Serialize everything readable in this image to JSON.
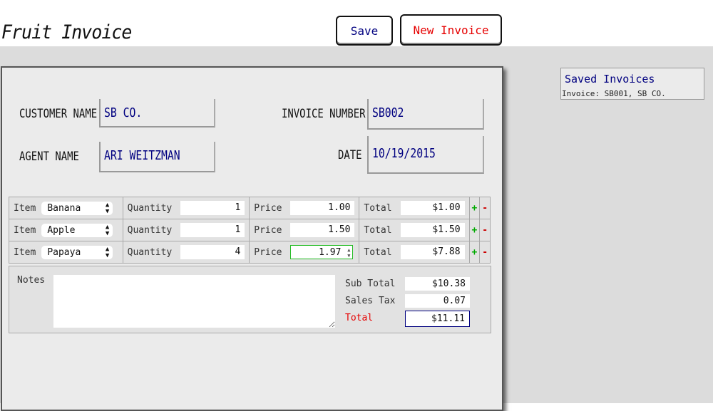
{
  "app": {
    "title": "Fruit Invoice"
  },
  "toolbar": {
    "save_label": "Save",
    "new_invoice_label": "New Invoice"
  },
  "invoice": {
    "customer_name_label": "CUSTOMER NAME",
    "customer_name": "SB CO.",
    "invoice_number_label": "INVOICE NUMBER",
    "invoice_number": "SB002",
    "agent_name_label": "AGENT NAME",
    "agent_name": "ARI WEITZMAN",
    "date_label": "DATE",
    "date": "10/19/2015"
  },
  "columns": {
    "item": "Item",
    "quantity": "Quantity",
    "price": "Price",
    "total": "Total",
    "add": "+",
    "remove": "-"
  },
  "line_items": [
    {
      "item": "Banana",
      "quantity": "1",
      "price": "1.00",
      "total": "$1.00"
    },
    {
      "item": "Apple",
      "quantity": "1",
      "price": "1.50",
      "total": "$1.50"
    },
    {
      "item": "Papaya",
      "quantity": "4",
      "price": "1.97",
      "total": "$7.88"
    }
  ],
  "summary": {
    "notes_label": "Notes",
    "notes_value": "",
    "subtotal_label": "Sub Total",
    "subtotal": "$10.38",
    "sales_tax_label": "Sales Tax",
    "sales_tax": "0.07",
    "total_label": "Total",
    "total": "$11.11",
    "total_label_color": "#e60000"
  },
  "saved": {
    "title": "Saved Invoices",
    "items": [
      {
        "label": "Invoice: SB001, SB CO."
      }
    ]
  },
  "icons": {
    "select_arrows": "up-down-arrows-icon",
    "spinner": "spinner-icon"
  }
}
